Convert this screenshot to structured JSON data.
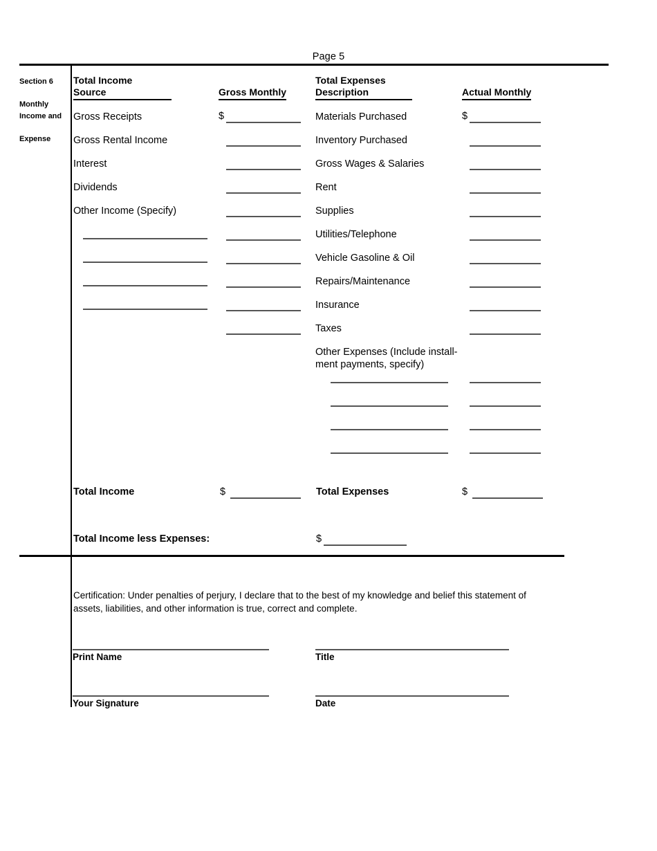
{
  "page": {
    "page_number": "Page 5"
  },
  "section": {
    "labels": [
      "Section 6",
      "Monthly\nIncome and",
      "Expense"
    ]
  },
  "headers": {
    "income_line1": "Total Income",
    "income_line2": "Source",
    "gross_monthly": "Gross Monthly",
    "expense_line1": "Total Expenses",
    "expense_line2": "Description",
    "actual_monthly": "Actual Monthly"
  },
  "income_rows": [
    "Gross Receipts",
    "Gross Rental Income",
    "Interest",
    "Dividends",
    "Other Income (Specify)"
  ],
  "expense_rows": [
    "Materials Purchased",
    "Inventory Purchased",
    "Gross Wages & Salaries",
    "Rent",
    "Supplies",
    "Utilities/Telephone",
    "Vehicle Gasoline & Oil",
    "Repairs/Maintenance",
    "Insurance",
    "Taxes"
  ],
  "other_expenses_label": "Other Expenses (Include install-\nment payments, specify)",
  "currency_symbol": "$",
  "totals": {
    "total_income": "Total Income",
    "total_expenses": "Total  Expenses",
    "total_income_less_expenses": "Total Income less Expenses:"
  },
  "certification": {
    "text": "Certification: Under penalties of perjury, I declare that to the best of my knowledge and belief this statement of assets, liabilities, and other information is true, correct and complete."
  },
  "signature": {
    "print_name": "Print Name",
    "title": "Title",
    "your_signature": "Your Signature",
    "date": "Date"
  }
}
